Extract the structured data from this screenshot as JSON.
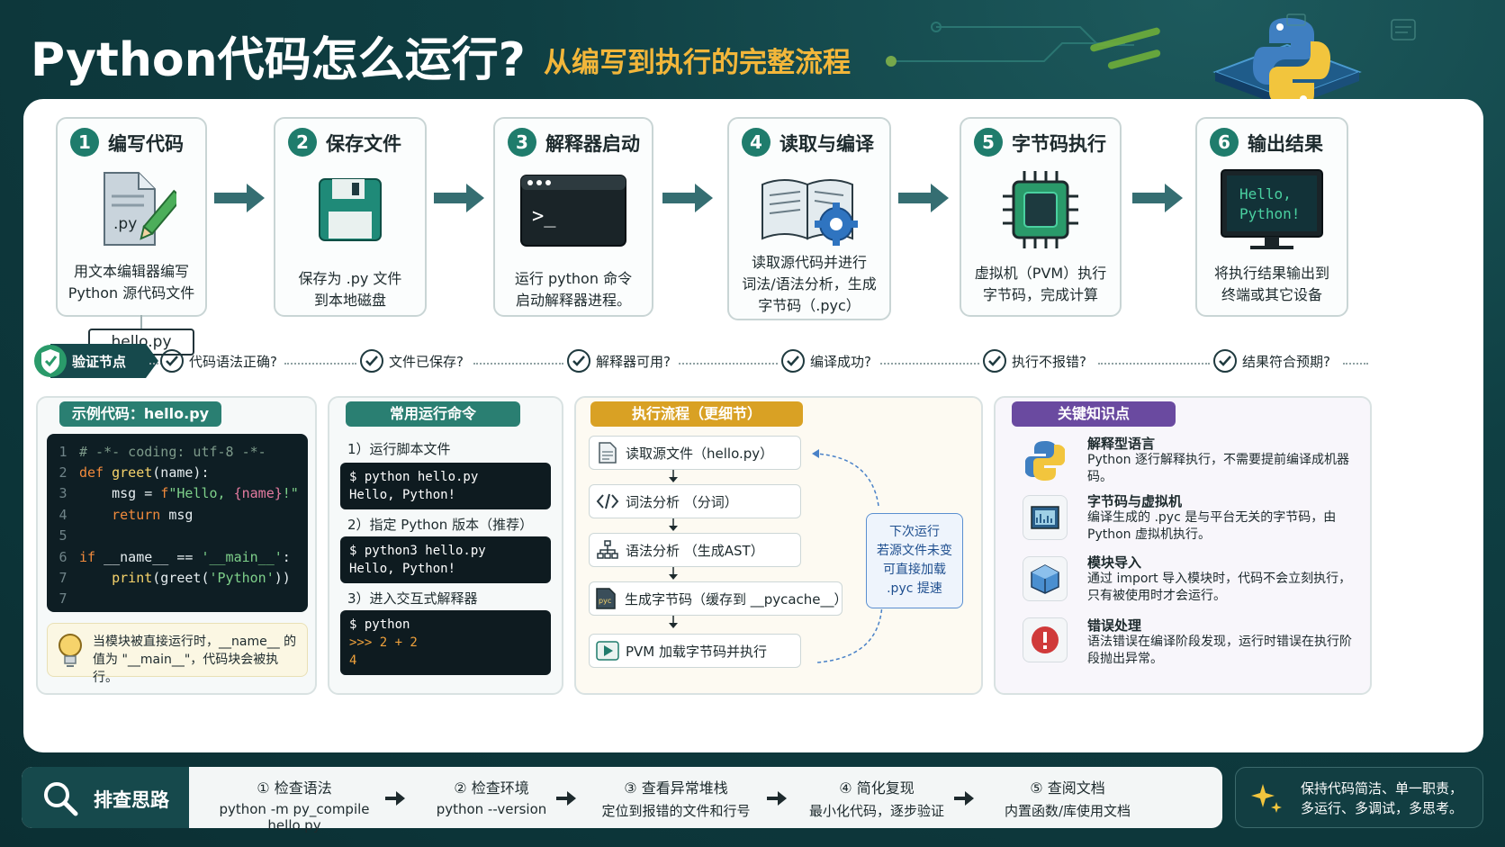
{
  "header": {
    "title": "Python代码怎么运行?",
    "subtitle": "从编写到执行的完整流程"
  },
  "steps": [
    {
      "num": "1",
      "title": "编写代码",
      "desc1": "用文本编辑器编写",
      "desc2": "Python 源代码文件",
      "icon_label": ".py",
      "icon": "file-pencil-icon"
    },
    {
      "num": "2",
      "title": "保存文件",
      "desc1": "保存为 .py 文件",
      "desc2": "到本地磁盘",
      "icon": "floppy-disk-icon"
    },
    {
      "num": "3",
      "title": "解释器启动",
      "desc1": "运行 python 命令",
      "desc2": "启动解释器进程。",
      "icon_label": ">_",
      "icon": "terminal-icon"
    },
    {
      "num": "4",
      "title": "读取与编译",
      "desc1": "读取源代码并进行",
      "desc2": "词法/语法分析，生成",
      "desc3": "字节码（.pyc）",
      "icon": "book-gear-icon"
    },
    {
      "num": "5",
      "title": "字节码执行",
      "desc1": "虚拟机（PVM）执行",
      "desc2": "字节码，完成计算",
      "icon": "chip-icon"
    },
    {
      "num": "6",
      "title": "输出结果",
      "desc1": "将执行结果输出到",
      "desc2": "终端或其它设备",
      "icon_label1": "Hello,",
      "icon_label2": "Python!",
      "icon": "monitor-icon"
    }
  ],
  "file_tag": "hello.py",
  "verify": {
    "badge": "验证节点",
    "checks": [
      "代码语法正确?",
      "文件已保存?",
      "解释器可用?",
      "编译成功?",
      "执行不报错?",
      "结果符合预期?"
    ]
  },
  "example": {
    "title": "示例代码：hello.py",
    "lines": [
      {
        "n": "1"
      },
      {
        "n": "2"
      },
      {
        "n": "3"
      },
      {
        "n": "4"
      },
      {
        "n": "5"
      },
      {
        "n": "6"
      },
      {
        "n": "7"
      },
      {
        "n": "7"
      }
    ],
    "code": {
      "l1": "# -*- coding: utf-8 -*-",
      "l2_kw": "def",
      "l2_fn": "greet",
      "l2_rest": "(name):",
      "l3_a": "    msg = ",
      "l3_f": "f",
      "l3_s1": "\"Hello, ",
      "l3_b": "{name}",
      "l3_s2": "!\"",
      "l4_kw": "    return",
      "l4_rest": " msg",
      "l6_kw": "if",
      "l6_rest": " __name__ == ",
      "l6_s": "'__main__'",
      "l6_end": ":",
      "l7_fn": "    print",
      "l7_a": "(greet(",
      "l7_s": "'Python'",
      "l7_b": "))"
    },
    "tip": "当模块被直接运行时，__name__ 的值为 \"__main__\"，代码块会被执行。"
  },
  "commands": {
    "title": "常用运行命令",
    "h1": "1）运行脚本文件",
    "t1a": "$ python hello.py",
    "t1b": "Hello, Python!",
    "h2": "2）指定 Python 版本（推荐）",
    "t2a": "$ python3 hello.py",
    "t2b": "Hello, Python!",
    "h3": "3）进入交互式解释器",
    "t3a": "$ python",
    "t3b": ">>> 2 + 2",
    "t3c": "4"
  },
  "flow": {
    "title": "执行流程（更细节）",
    "items": [
      "读取源文件（hello.py）",
      "词法分析 （分词）",
      "语法分析 （生成AST）",
      "生成字节码（缓存到 __pycache__）",
      "PVM 加载字节码并执行"
    ],
    "pyc_label": "pyc",
    "cache_note": [
      "下次运行",
      "若源文件未变",
      "可直接加载",
      ".pyc 提速"
    ]
  },
  "knowledge": {
    "title": "关键知识点",
    "items": [
      {
        "t": "解释型语言",
        "d": "Python 逐行解释执行，不需要提前编译成机器码。"
      },
      {
        "t": "字节码与虚拟机",
        "d": "编译生成的 .pyc 是与平台无关的字节码，由 Python 虚拟机执行。"
      },
      {
        "t": "模块导入",
        "d": "通过 import 导入模块时，代码不会立刻执行，只有被使用时才会运行。"
      },
      {
        "t": "错误处理",
        "d": "语法错误在编译阶段发现，运行时错误在执行阶段抛出异常。"
      }
    ]
  },
  "troubleshoot": {
    "title": "排查思路",
    "steps": [
      {
        "t": "① 检查语法",
        "d": "python -m py_compile hello.py"
      },
      {
        "t": "② 检查环境",
        "d": "python --version"
      },
      {
        "t": "③ 查看异常堆栈",
        "d": "定位到报错的文件和行号"
      },
      {
        "t": "④ 简化复现",
        "d": "最小化代码，逐步验证"
      },
      {
        "t": "⑤ 查阅文档",
        "d": "内置函数/库使用文档"
      }
    ]
  },
  "motto": {
    "l1": "保持代码简洁、单一职责，",
    "l2": "多运行、多调试，多思考。"
  },
  "colors": {
    "teal": "#1f7c6c",
    "orange": "#e0a020",
    "purple": "#6a4aa0",
    "dark": "#0b2f33"
  }
}
